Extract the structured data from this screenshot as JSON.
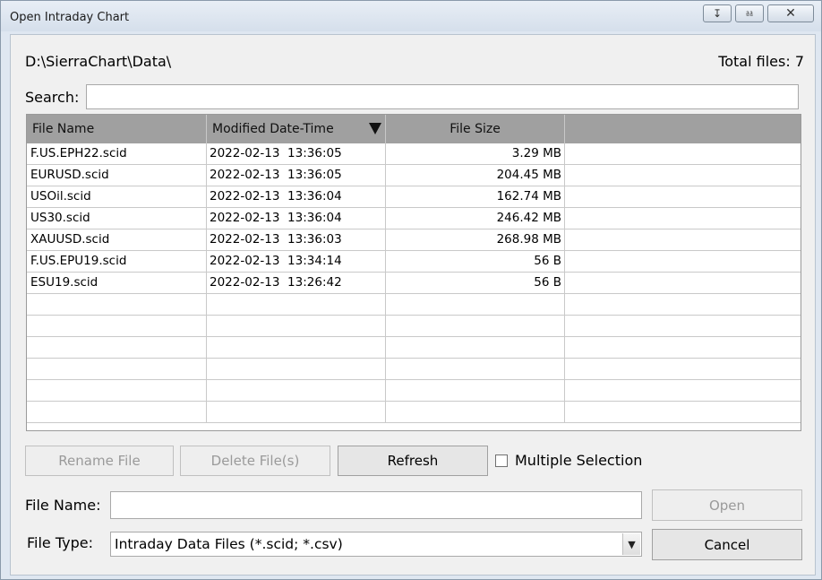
{
  "window": {
    "title": "Open Intraday Chart",
    "controls": {
      "expand_icon": "double-chevron-down-icon",
      "pin_icon": "pin-icon",
      "close_icon": "close-icon"
    }
  },
  "path": "D:\\SierraChart\\Data\\",
  "total_files": "Total files: 7",
  "search": {
    "label": "Search:",
    "value": "",
    "placeholder": ""
  },
  "table": {
    "columns": [
      "File Name",
      "Modified Date-Time",
      "File Size",
      ""
    ],
    "sort_indicator": "sort-descending-icon",
    "rows": [
      [
        "F.US.EPH22.scid",
        "2022-02-13  13:36:05",
        "3.29 MB"
      ],
      [
        "EURUSD.scid",
        "2022-02-13  13:36:05",
        "204.45 MB"
      ],
      [
        "USOil.scid",
        "2022-02-13  13:36:04",
        "162.74 MB"
      ],
      [
        "US30.scid",
        "2022-02-13  13:36:04",
        "246.42 MB"
      ],
      [
        "XAUUSD.scid",
        "2022-02-13  13:36:03",
        "268.98 MB"
      ],
      [
        "F.US.EPU19.scid",
        "2022-02-13  13:34:14",
        "56 B"
      ],
      [
        "ESU19.scid",
        "2022-02-13  13:26:42",
        "56 B"
      ],
      [
        "",
        "",
        ""
      ],
      [
        "",
        "",
        ""
      ],
      [
        "",
        "",
        ""
      ],
      [
        "",
        "",
        ""
      ],
      [
        "",
        "",
        ""
      ],
      [
        "",
        "",
        ""
      ]
    ]
  },
  "buttons": {
    "rename": "Rename File",
    "delete": "Delete File(s)",
    "refresh": "Refresh",
    "open": "Open",
    "cancel": "Cancel"
  },
  "multiple_selection": {
    "label": "Multiple Selection",
    "checked": false
  },
  "file_name": {
    "label": "File Name:",
    "value": ""
  },
  "file_type": {
    "label": "File Type:",
    "value": "Intraday Data Files (*.scid; *.csv)"
  },
  "colors": {
    "header_bg": "#a0a0a0",
    "dialog_bg": "#f0f0f0",
    "frame_bg": "#dfe7f1",
    "disabled_text": "#9a9a9a"
  }
}
